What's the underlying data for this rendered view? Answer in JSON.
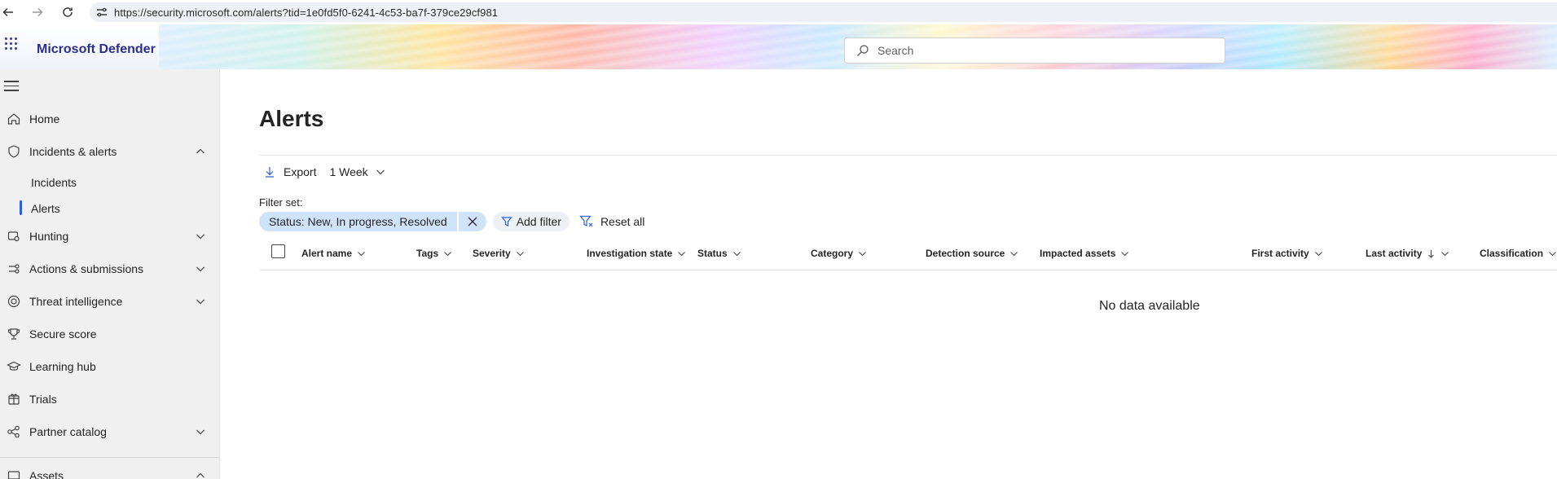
{
  "browser": {
    "url": "https://security.microsoft.com/alerts?tid=1e0fd5f0-6241-4c53-ba7f-379ce29cf981"
  },
  "header": {
    "brand": "Microsoft Defender",
    "search_placeholder": "Search"
  },
  "sidebar": {
    "items": [
      {
        "label": "Home",
        "icon": "home-icon"
      },
      {
        "label": "Incidents & alerts",
        "icon": "shield-icon",
        "expanded": true
      },
      {
        "label": "Hunting",
        "icon": "hunting-icon"
      },
      {
        "label": "Actions & submissions",
        "icon": "actions-icon"
      },
      {
        "label": "Threat intelligence",
        "icon": "threat-intel-icon"
      },
      {
        "label": "Secure score",
        "icon": "trophy-icon"
      },
      {
        "label": "Learning hub",
        "icon": "learning-icon"
      },
      {
        "label": "Trials",
        "icon": "trials-icon"
      },
      {
        "label": "Partner catalog",
        "icon": "partner-icon"
      },
      {
        "label": "Assets",
        "icon": "assets-icon",
        "expanded": true
      }
    ],
    "sub_items": [
      "Incidents",
      "Alerts"
    ],
    "active_sub_item": "Alerts",
    "accent_color": "#2b5fd9"
  },
  "main": {
    "title": "Alerts",
    "toolbar": {
      "export_label": "Export",
      "range_label": "1 Week"
    },
    "filter": {
      "label": "Filter set:",
      "status_key": "Status:",
      "status_value": "New, In progress, Resolved",
      "add_filter_label": "Add filter",
      "reset_label": "Reset all"
    },
    "columns": [
      "Alert name",
      "Tags",
      "Severity",
      "Investigation state",
      "Status",
      "Category",
      "Detection source",
      "Impacted assets",
      "First activity",
      "Last activity",
      "Classification"
    ],
    "sorted_column": "Last activity",
    "empty_message": "No data available"
  }
}
